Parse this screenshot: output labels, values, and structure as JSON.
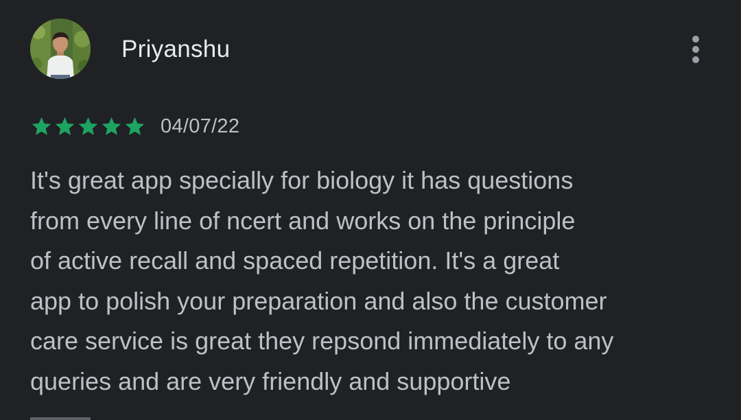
{
  "review": {
    "author": "Priyanshu",
    "avatar_icon": "user-avatar-photo",
    "more_icon": "more-vert-icon",
    "rating": 5,
    "rating_max": 5,
    "star_color": "#1ea362",
    "date": "04/07/22",
    "text_lines": [
      "It's great app specially for biology it has questions",
      "from every line of ncert and works on the principle",
      "of active recall and spaced repetition. It's a great",
      "app to polish your preparation and also the customer",
      "care service is great they repsond immediately to any",
      "queries and are very friendly and supportive"
    ]
  }
}
